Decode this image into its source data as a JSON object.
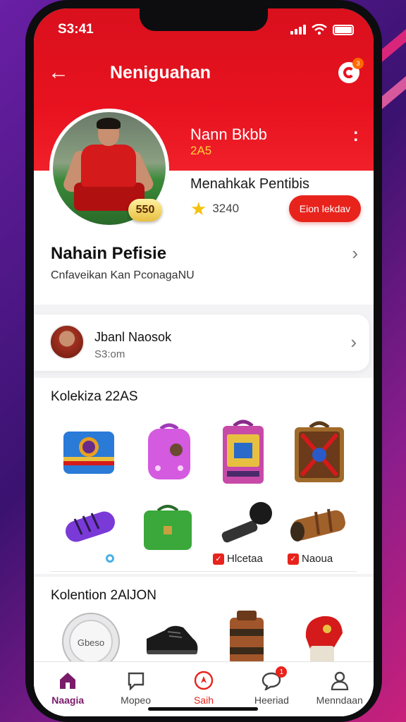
{
  "status_bar": {
    "time": "S3:41"
  },
  "app_bar": {
    "title": "Neniguahan",
    "notification_count": "3"
  },
  "profile": {
    "name": "Nann Bkbb",
    "year": "2A5",
    "rating": "550",
    "subtitle": "Menahkak Pentibis",
    "coins": "3240",
    "cta_label": "Eion lekdav"
  },
  "info": {
    "title": "Nahain Pefisie",
    "subtitle": "Cnfaveikan Kan PconagaNU"
  },
  "friend": {
    "name": "Jbanl Naosok",
    "meta": "S3:om"
  },
  "collection1": {
    "title": "Kolekiza 22AS",
    "items": [
      {
        "name": "blue-chest"
      },
      {
        "name": "pink-backpack"
      },
      {
        "name": "arcade-case"
      },
      {
        "name": "wooden-chest"
      },
      {
        "name": "purple-tube"
      },
      {
        "name": "green-bag"
      },
      {
        "name": "black-microphone",
        "label": "Hlcetaa"
      },
      {
        "name": "wooden-cannon",
        "label": "Naoua"
      }
    ]
  },
  "collection2": {
    "title": "Kolention 2AlJON",
    "items": [
      {
        "name": "white-drum",
        "text": "Gbeso"
      },
      {
        "name": "black-shoe"
      },
      {
        "name": "brown-strap"
      },
      {
        "name": "red-glove"
      }
    ]
  },
  "bottom_nav": {
    "items": [
      {
        "label": "Naagia",
        "icon": "home-icon"
      },
      {
        "label": "Mopeo",
        "icon": "chat-square-icon"
      },
      {
        "label": "Saih",
        "icon": "compass-icon"
      },
      {
        "label": "Heeriad",
        "icon": "message-icon",
        "badge": "1"
      },
      {
        "label": "Menndaan",
        "icon": "profile-icon"
      }
    ]
  },
  "colors": {
    "primary": "#e8121f",
    "accent": "#ffd23a",
    "nav_active": "#7a1a6a"
  }
}
